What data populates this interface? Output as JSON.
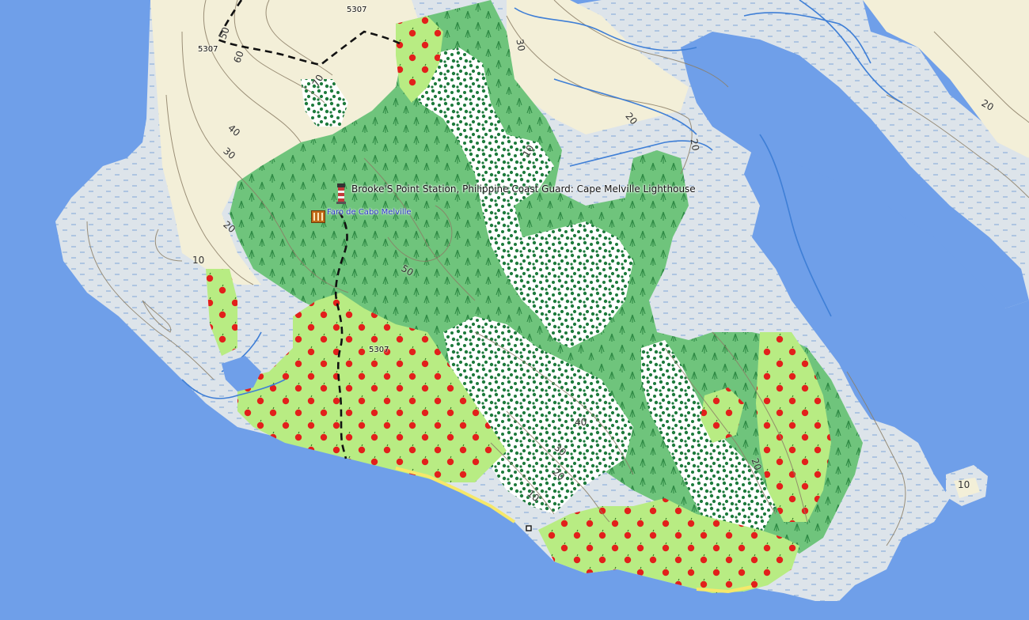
{
  "map": {
    "colors": {
      "sea": "#6f9fe9",
      "land": "#f3efd8",
      "wetland": "#dde4ea",
      "forest": "#6fc47c",
      "forest_dark": "#5fb36c",
      "orchard": "#b8ec83",
      "orchard_light": "#d6f59a",
      "scrub": "#ffffff",
      "scrub_dots": "#1d7a3c",
      "contour": "#8b7e66",
      "stream": "#3f7fd6",
      "path": "#111111",
      "beach": "#f6e86a"
    },
    "pois": [
      {
        "label": "Brooke'S Point Station, Philippine Coast Guard: Cape Melville Lighthouse",
        "icon": "lighthouse-icon"
      },
      {
        "label": "Faro de Cabo Melville",
        "icon": "historic-building-icon"
      }
    ],
    "road_refs": [
      "5307",
      "5307",
      "5307"
    ],
    "contour_labels": [
      "50",
      "60",
      "70",
      "40",
      "30",
      "20",
      "10",
      "50",
      "10",
      "20",
      "30",
      "40",
      "20",
      "10",
      "20",
      "30",
      "20",
      "10",
      "20"
    ]
  }
}
